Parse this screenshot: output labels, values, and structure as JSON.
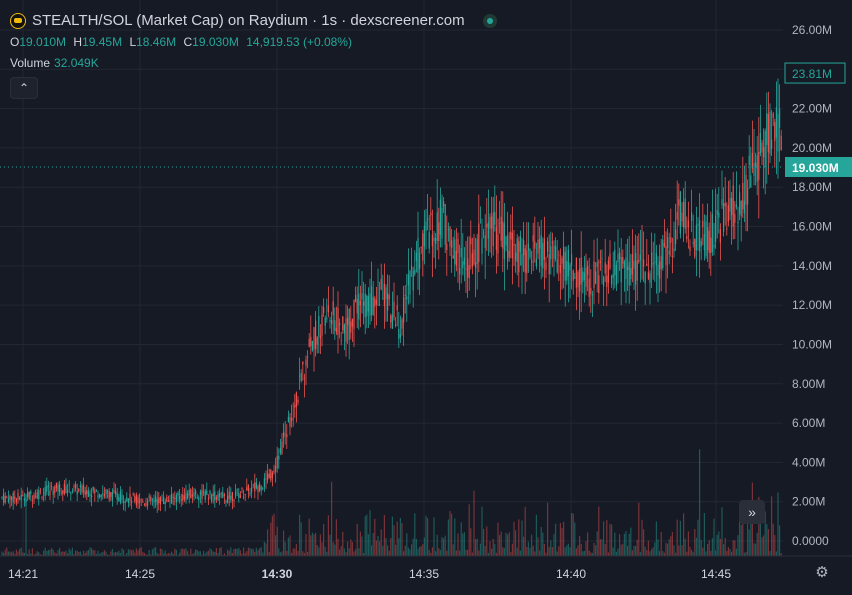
{
  "header": {
    "title": "STEALTH/SOL (Market Cap) on Raydium · 1s · dexscreener.com",
    "ohlc": {
      "o_label": "O",
      "o": "19.010M",
      "h_label": "H",
      "h": "19.45M",
      "l_label": "L",
      "l": "18.46M",
      "c_label": "C",
      "c": "19.030M",
      "change": "14,919.53 (+0.08%)"
    },
    "volume_label": "Volume",
    "volume_value": "32.049K"
  },
  "controls": {
    "collapse": "⌃",
    "scroll_to_realtime": "»",
    "settings": "⚙"
  },
  "colors": {
    "up": "#26a69a",
    "down": "#ef5350",
    "background": "#161a25",
    "grid": "#232733",
    "text": "#d1d4dc"
  },
  "chart_data": {
    "type": "candlestick",
    "y_unit": "M",
    "ylim": [
      -0.6,
      26.5
    ],
    "y_ticks": [
      "26.00M",
      "24.00M",
      "22.00M",
      "20.00M",
      "18.00M",
      "16.00M",
      "14.00M",
      "12.00M",
      "10.00M",
      "8.00M",
      "6.00M",
      "4.00M",
      "2.00M",
      "0.0000"
    ],
    "x_ticks": [
      "14:21",
      "14:25",
      "14:30",
      "14:35",
      "14:40",
      "14:45"
    ],
    "x_tick_bold": [
      false,
      false,
      true,
      false,
      false,
      false
    ],
    "last_price_label": "19.030M",
    "last_price_value": 19.03,
    "crosshair_label": "23.81M",
    "crosshair_value": 23.81,
    "price_path": [
      [
        0,
        2.2
      ],
      [
        1.2,
        2.7
      ],
      [
        2.5,
        2.5
      ],
      [
        3.5,
        2.2
      ],
      [
        4.2,
        2.0
      ],
      [
        5.0,
        2.1
      ],
      [
        6.0,
        2.4
      ],
      [
        7.2,
        2.2
      ],
      [
        8.0,
        2.6
      ],
      [
        8.6,
        3.0
      ],
      [
        8.9,
        3.6
      ],
      [
        9.2,
        5.0
      ],
      [
        9.5,
        6.5
      ],
      [
        9.8,
        8.0
      ],
      [
        10.1,
        10.0
      ],
      [
        10.5,
        11.0
      ],
      [
        10.9,
        11.5
      ],
      [
        11.3,
        10.5
      ],
      [
        11.7,
        11.8
      ],
      [
        12.1,
        12.0
      ],
      [
        12.5,
        12.8
      ],
      [
        12.9,
        11.5
      ],
      [
        13.2,
        11.0
      ],
      [
        13.5,
        13.0
      ],
      [
        13.9,
        15.0
      ],
      [
        14.2,
        16.0
      ],
      [
        14.6,
        16.5
      ],
      [
        15.0,
        15.0
      ],
      [
        15.4,
        14.0
      ],
      [
        15.8,
        15.0
      ],
      [
        16.2,
        16.0
      ],
      [
        16.6,
        15.5
      ],
      [
        17.2,
        14.5
      ],
      [
        17.8,
        14.8
      ],
      [
        18.4,
        14.3
      ],
      [
        19.0,
        14.0
      ],
      [
        19.6,
        13.2
      ],
      [
        20.2,
        13.8
      ],
      [
        20.8,
        14.0
      ],
      [
        21.4,
        13.8
      ],
      [
        22.0,
        14.2
      ],
      [
        22.4,
        15.0
      ],
      [
        22.8,
        16.8
      ],
      [
        23.2,
        15.5
      ],
      [
        23.6,
        15.3
      ],
      [
        24.0,
        16.0
      ],
      [
        24.5,
        16.8
      ],
      [
        24.9,
        17.5
      ],
      [
        25.3,
        19.0
      ],
      [
        25.6,
        20.0
      ],
      [
        25.9,
        20.8
      ]
    ],
    "x_range": [
      0,
      25.9
    ]
  }
}
